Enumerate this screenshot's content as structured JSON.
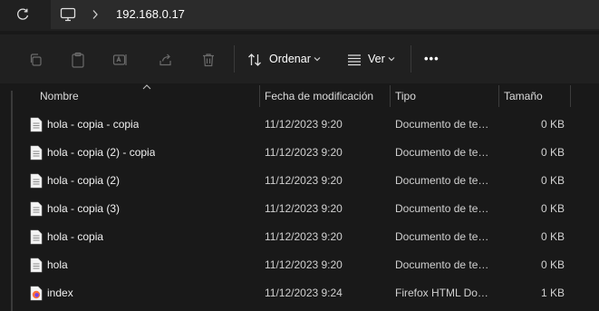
{
  "address": {
    "path": "192.168.0.17"
  },
  "toolbar": {
    "sort_label": "Ordenar",
    "view_label": "Ver",
    "more_label": "•••"
  },
  "columns": {
    "name": "Nombre",
    "date": "Fecha de modificación",
    "type": "Tipo",
    "size": "Tamaño"
  },
  "files": [
    {
      "name": "hola - copia - copia",
      "date": "11/12/2023 9:20",
      "type": "Documento de texto",
      "size": "0 KB",
      "icon": "text-file-icon"
    },
    {
      "name": "hola - copia (2) - copia",
      "date": "11/12/2023 9:20",
      "type": "Documento de texto",
      "size": "0 KB",
      "icon": "text-file-icon"
    },
    {
      "name": "hola - copia (2)",
      "date": "11/12/2023 9:20",
      "type": "Documento de texto",
      "size": "0 KB",
      "icon": "text-file-icon"
    },
    {
      "name": "hola - copia (3)",
      "date": "11/12/2023 9:20",
      "type": "Documento de texto",
      "size": "0 KB",
      "icon": "text-file-icon"
    },
    {
      "name": "hola - copia",
      "date": "11/12/2023 9:20",
      "type": "Documento de texto",
      "size": "0 KB",
      "icon": "text-file-icon"
    },
    {
      "name": "hola",
      "date": "11/12/2023 9:20",
      "type": "Documento de texto",
      "size": "0 KB",
      "icon": "text-file-icon"
    },
    {
      "name": "index",
      "date": "11/12/2023 9:24",
      "type": "Firefox HTML Document",
      "size": "1 KB",
      "icon": "firefox-html-icon"
    }
  ]
}
